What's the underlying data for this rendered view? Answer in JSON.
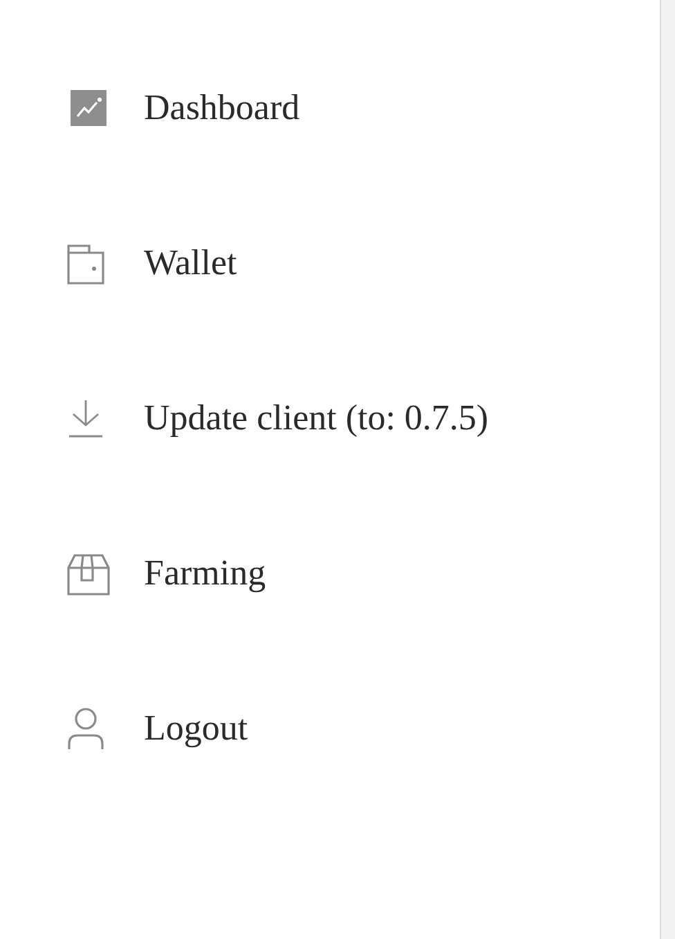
{
  "menu": {
    "items": [
      {
        "kind": "chart",
        "label": "Dashboard"
      },
      {
        "kind": "wallet",
        "label": "Wallet"
      },
      {
        "kind": "download",
        "label": "Update client (to: 0.7.5)"
      },
      {
        "kind": "box",
        "label": "Farming"
      },
      {
        "kind": "user",
        "label": "Logout"
      }
    ]
  }
}
